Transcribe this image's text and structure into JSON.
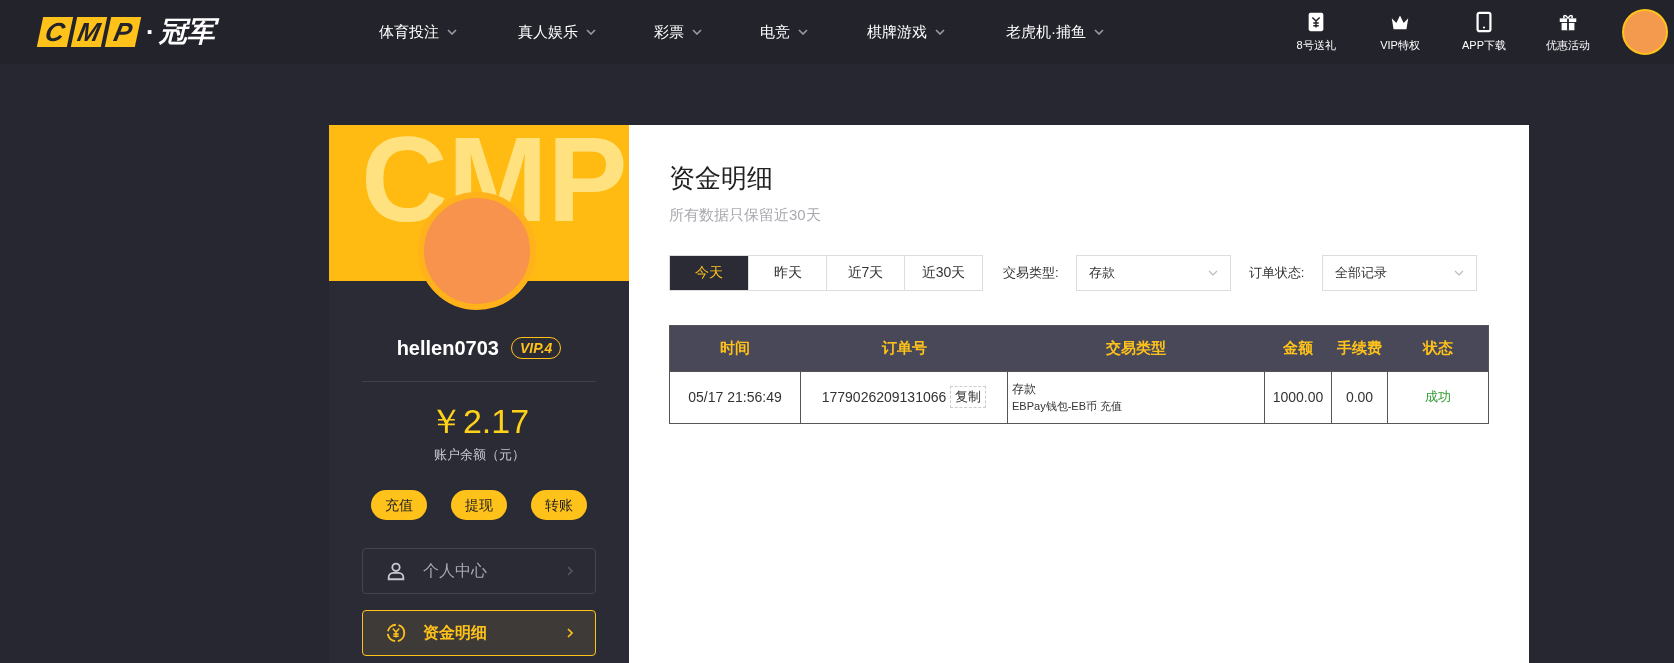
{
  "header": {
    "logo": {
      "letters": [
        "C",
        "M",
        "P"
      ],
      "separator": "·",
      "name": "冠军"
    },
    "nav": [
      {
        "label": "体育投注"
      },
      {
        "label": "真人娱乐"
      },
      {
        "label": "彩票"
      },
      {
        "label": "电竞"
      },
      {
        "label": "棋牌游戏"
      },
      {
        "label": "老虎机·捕鱼"
      }
    ],
    "links": [
      {
        "kind": "yen",
        "label": "8号送礼"
      },
      {
        "kind": "crown",
        "label": "VIP特权"
      },
      {
        "kind": "tablet",
        "label": "APP下载"
      },
      {
        "kind": "gift",
        "label": "优惠活动"
      }
    ]
  },
  "sidebar": {
    "banner_text": "CMP",
    "username": "hellen0703",
    "vip": "VIP.4",
    "balance": "￥2.17",
    "balance_label": "账户余额（元）",
    "actions": [
      "充值",
      "提现",
      "转账"
    ],
    "menu": [
      {
        "kind": "user",
        "label": "个人中心",
        "selected": false
      },
      {
        "kind": "money",
        "label": "资金明细",
        "selected": true
      }
    ]
  },
  "content": {
    "title": "资金明细",
    "subtitle": "所有数据只保留近30天",
    "date_tabs": [
      {
        "label": "今天",
        "selected": true
      },
      {
        "label": "昨天",
        "selected": false
      },
      {
        "label": "近7天",
        "selected": false
      },
      {
        "label": "近30天",
        "selected": false
      }
    ],
    "filters": [
      {
        "label": "交易类型:",
        "value": "存款"
      },
      {
        "label": "订单状态:",
        "value": "全部记录"
      }
    ],
    "table": {
      "columns": [
        "时间",
        "订单号",
        "交易类型",
        "金额",
        "手续费",
        "状态"
      ],
      "rows": [
        {
          "time": "05/17 21:56:49",
          "order_no": "1779026209131066",
          "copy": "复制",
          "type": "存款",
          "type_detail": "EBPay钱包-EB币 充值",
          "amount": "1000.00",
          "fee": "0.00",
          "status": "成功",
          "success": true
        }
      ]
    }
  }
}
